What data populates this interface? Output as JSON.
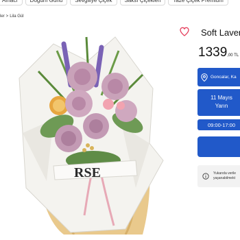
{
  "category_nav": [
    {
      "label": "Amacı"
    },
    {
      "label": "Doğum Günü"
    },
    {
      "label": "Sevgiliye Çiçek"
    },
    {
      "label": "Saksı Çiçekleri"
    },
    {
      "label": "Taze Çiçek Premium"
    }
  ],
  "breadcrumb": {
    "prev": "ler",
    "sep": ">",
    "current": "Lila Gül"
  },
  "product": {
    "title": "Soft Laver",
    "price_main": "1339",
    "price_small": ",00 TL",
    "image_banner_text": "RSE"
  },
  "delivery": {
    "location": "Goncalar, Ka",
    "date_line1": "11 Mayıs",
    "date_line2": "Yarın",
    "time_slot": "09:00-17:00"
  },
  "info_box": {
    "line1": "Yukarıda verile",
    "line2": "yaşanabilmekt"
  },
  "colors": {
    "accent": "#2159c9",
    "heart": "#e5405e",
    "info_bg": "#f2f2f2"
  }
}
